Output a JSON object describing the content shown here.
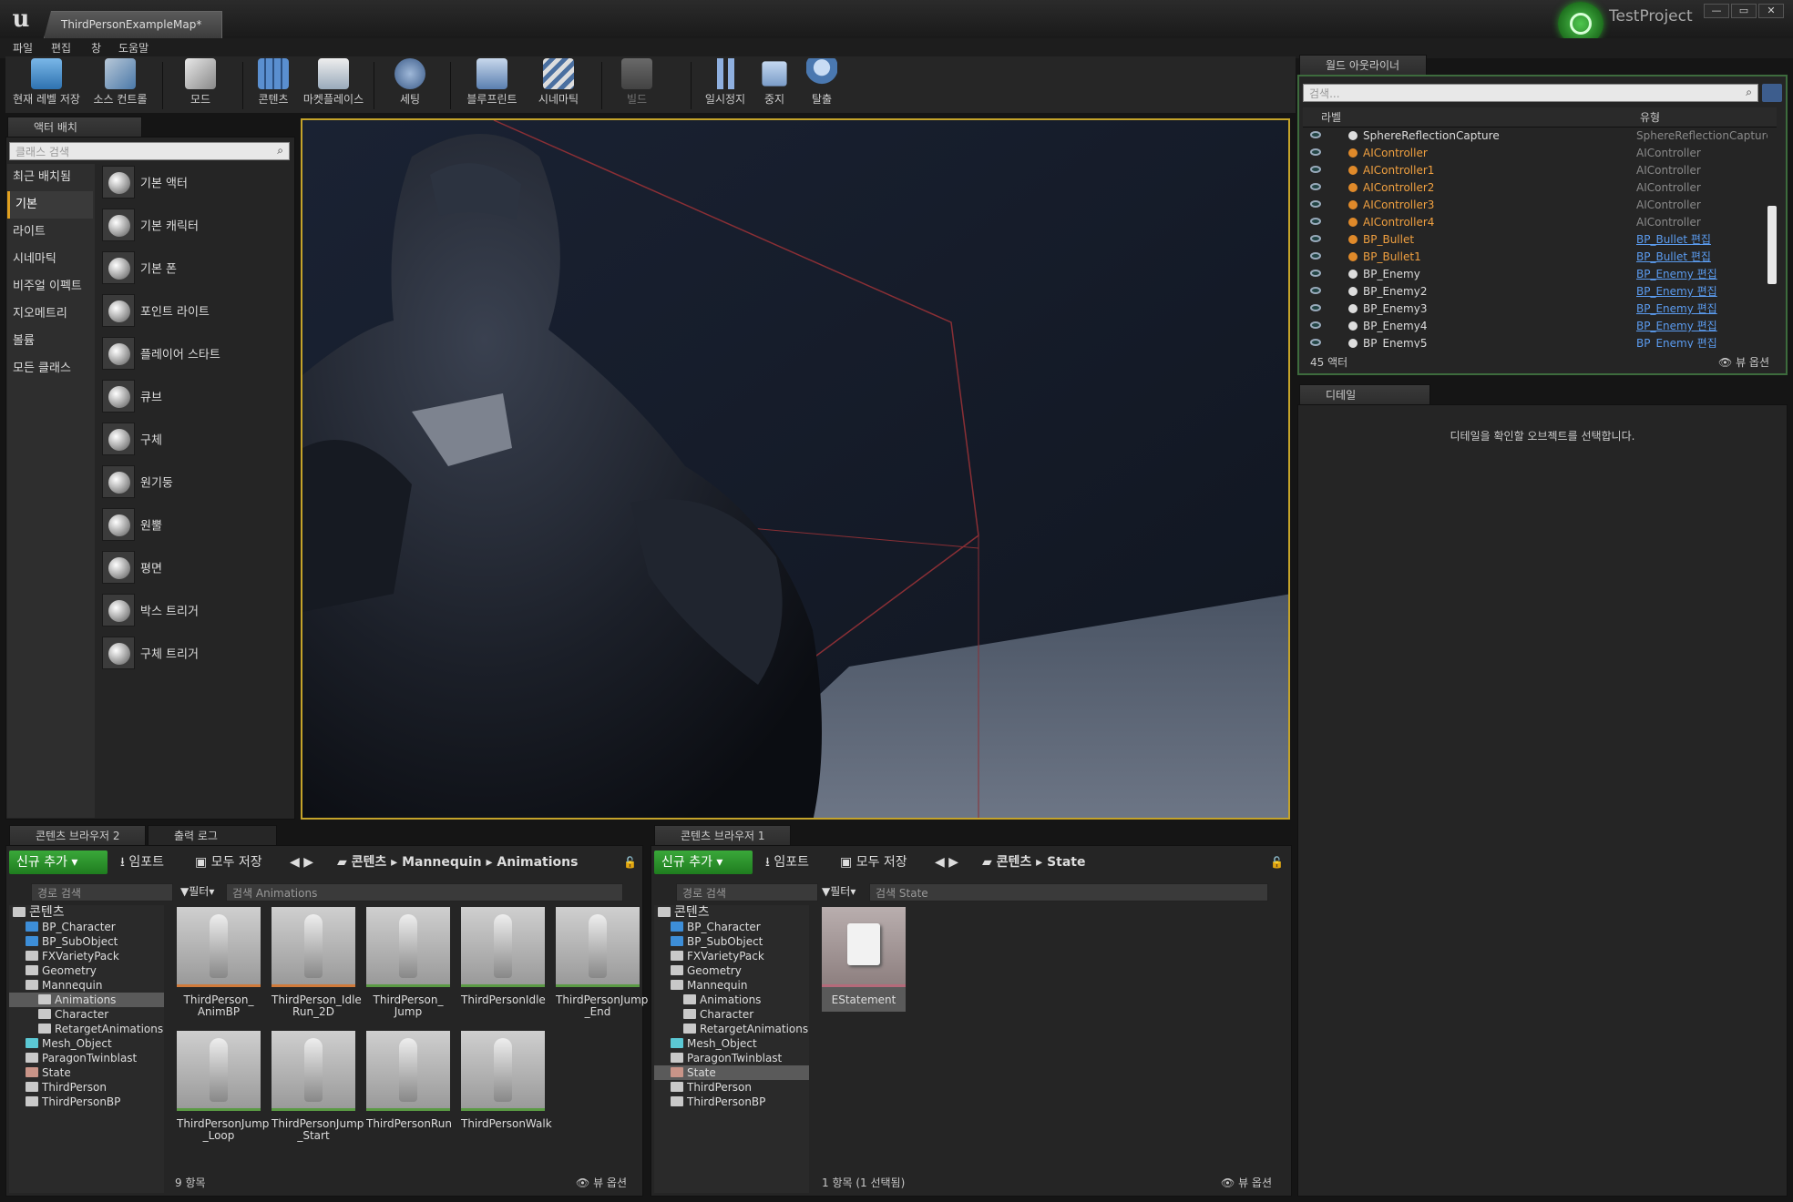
{
  "app": {
    "tab_title": "ThirdPersonExampleMap*",
    "project_name": "TestProject",
    "window_buttons": [
      "—",
      "▭",
      "✕"
    ]
  },
  "menu": [
    "파일",
    "편집",
    "창",
    "도움말"
  ],
  "toolbar": {
    "items": [
      {
        "label": "현재 레벨 저장",
        "icon": "save-icon"
      },
      {
        "label": "소스 컨트롤",
        "icon": "source-control-icon"
      },
      {
        "label": "모드",
        "icon": "modes-icon"
      },
      {
        "label": "콘텐츠",
        "icon": "content-icon"
      },
      {
        "label": "마켓플레이스",
        "icon": "marketplace-icon"
      },
      {
        "label": "세팅",
        "icon": "settings-icon"
      },
      {
        "label": "블루프린트",
        "icon": "blueprint-icon"
      },
      {
        "label": "시네마틱",
        "icon": "cinematics-icon"
      },
      {
        "label": "빌드",
        "icon": "build-icon"
      },
      {
        "label": "일시정지",
        "icon": "pause-icon"
      },
      {
        "label": "중지",
        "icon": "stop-icon"
      },
      {
        "label": "탈출",
        "icon": "eject-icon"
      }
    ]
  },
  "place_actors": {
    "tab_title": "액터 배치",
    "search_placeholder": "클래스 검색",
    "categories": [
      "최근 배치됨",
      "기본",
      "라이트",
      "시네마틱",
      "비주얼 이펙트",
      "지오메트리",
      "볼륨",
      "모든 클래스"
    ],
    "selected_category": "기본",
    "items": [
      "기본 액터",
      "기본 캐릭터",
      "기본 폰",
      "포인트 라이트",
      "플레이어 스타트",
      "큐브",
      "구체",
      "원기둥",
      "원뿔",
      "평면",
      "박스 트리거",
      "구체 트리거"
    ]
  },
  "world_outliner": {
    "tab_title": "월드 아웃라이너",
    "search_placeholder": "검색...",
    "col_label": "라벨",
    "col_type": "유형",
    "rows": [
      {
        "name": "SphereReflectionCapture",
        "type": "SphereReflectionCapture",
        "orange": false,
        "link": false
      },
      {
        "name": "AIController",
        "type": "AIController",
        "orange": true,
        "link": false
      },
      {
        "name": "AIController1",
        "type": "AIController",
        "orange": true,
        "link": false
      },
      {
        "name": "AIController2",
        "type": "AIController",
        "orange": true,
        "link": false
      },
      {
        "name": "AIController3",
        "type": "AIController",
        "orange": true,
        "link": false
      },
      {
        "name": "AIController4",
        "type": "AIController",
        "orange": true,
        "link": false
      },
      {
        "name": "BP_Bullet",
        "type": "BP_Bullet 편집",
        "orange": true,
        "link": true
      },
      {
        "name": "BP_Bullet1",
        "type": "BP_Bullet 편집",
        "orange": true,
        "link": true
      },
      {
        "name": "BP_Enemy",
        "type": "BP_Enemy 편집",
        "orange": false,
        "link": true
      },
      {
        "name": "BP_Enemy2",
        "type": "BP_Enemy 편집",
        "orange": false,
        "link": true
      },
      {
        "name": "BP_Enemy3",
        "type": "BP_Enemy 편집",
        "orange": false,
        "link": true
      },
      {
        "name": "BP_Enemy4",
        "type": "BP_Enemy 편집",
        "orange": false,
        "link": true
      },
      {
        "name": "BP_Enemy5",
        "type": "BP_Enemy 편집",
        "orange": false,
        "link": true
      }
    ],
    "actor_count": "45 액터",
    "view_options": "뷰 옵션"
  },
  "details": {
    "tab_title": "디테일",
    "empty_message": "디테일을 확인할 오브젝트를 선택합니다."
  },
  "content_browser_2": {
    "tab_title": "콘텐츠 브라우저 2",
    "output_tab": "출력 로그",
    "add_new": "신규 추가",
    "import": "임포트",
    "save_all": "모두 저장",
    "path": [
      "콘텐츠",
      "Mannequin",
      "Animations"
    ],
    "path_search": "경로 검색",
    "filter": "필터",
    "search_placeholder": "검색 Animations",
    "tree": [
      {
        "label": "콘텐츠",
        "depth": 0,
        "color": "grey",
        "selected": false
      },
      {
        "label": "BP_Character",
        "depth": 1,
        "color": "blue",
        "selected": false
      },
      {
        "label": "BP_SubObject",
        "depth": 1,
        "color": "blue",
        "selected": false
      },
      {
        "label": "FXVarietyPack",
        "depth": 1,
        "color": "grey",
        "selected": false
      },
      {
        "label": "Geometry",
        "depth": 1,
        "color": "grey",
        "selected": false
      },
      {
        "label": "Mannequin",
        "depth": 1,
        "color": "grey",
        "selected": false
      },
      {
        "label": "Animations",
        "depth": 2,
        "color": "grey",
        "selected": true
      },
      {
        "label": "Character",
        "depth": 2,
        "color": "grey",
        "selected": false
      },
      {
        "label": "RetargetAnimations",
        "depth": 2,
        "color": "grey",
        "selected": false
      },
      {
        "label": "Mesh_Object",
        "depth": 1,
        "color": "cyan",
        "selected": false
      },
      {
        "label": "ParagonTwinblast",
        "depth": 1,
        "color": "grey",
        "selected": false
      },
      {
        "label": "State",
        "depth": 1,
        "color": "pink",
        "selected": false
      },
      {
        "label": "ThirdPerson",
        "depth": 1,
        "color": "grey",
        "selected": false
      },
      {
        "label": "ThirdPersonBP",
        "depth": 1,
        "color": "grey",
        "selected": false
      }
    ],
    "assets": [
      {
        "label": "ThirdPerson_\nAnimBP",
        "kind": "anim"
      },
      {
        "label": "ThirdPerson_Idle\nRun_2D",
        "kind": "anim"
      },
      {
        "label": "ThirdPerson_\nJump",
        "kind": "seq"
      },
      {
        "label": "ThirdPersonIdle",
        "kind": "seq"
      },
      {
        "label": "ThirdPersonJump\n_End",
        "kind": "seq"
      },
      {
        "label": "ThirdPersonJump\n_Loop",
        "kind": "seq"
      },
      {
        "label": "ThirdPersonJump\n_Start",
        "kind": "seq"
      },
      {
        "label": "ThirdPersonRun",
        "kind": "seq"
      },
      {
        "label": "ThirdPersonWalk",
        "kind": "seq"
      }
    ],
    "count": "9 항목",
    "view_options": "뷰 옵션"
  },
  "content_browser_1": {
    "tab_title": "콘텐츠 브라우저 1",
    "add_new": "신규 추가",
    "import": "임포트",
    "save_all": "모두 저장",
    "path": [
      "콘텐츠",
      "State"
    ],
    "path_search": "경로 검색",
    "filter": "필터",
    "search_placeholder": "검색 State",
    "tree": [
      {
        "label": "콘텐츠",
        "depth": 0,
        "color": "grey",
        "selected": false
      },
      {
        "label": "BP_Character",
        "depth": 1,
        "color": "blue",
        "selected": false
      },
      {
        "label": "BP_SubObject",
        "depth": 1,
        "color": "blue",
        "selected": false
      },
      {
        "label": "FXVarietyPack",
        "depth": 1,
        "color": "grey",
        "selected": false
      },
      {
        "label": "Geometry",
        "depth": 1,
        "color": "grey",
        "selected": false
      },
      {
        "label": "Mannequin",
        "depth": 1,
        "color": "grey",
        "selected": false
      },
      {
        "label": "Animations",
        "depth": 2,
        "color": "grey",
        "selected": false
      },
      {
        "label": "Character",
        "depth": 2,
        "color": "grey",
        "selected": false
      },
      {
        "label": "RetargetAnimations",
        "depth": 2,
        "color": "grey",
        "selected": false
      },
      {
        "label": "Mesh_Object",
        "depth": 1,
        "color": "cyan",
        "selected": false
      },
      {
        "label": "ParagonTwinblast",
        "depth": 1,
        "color": "grey",
        "selected": false
      },
      {
        "label": "State",
        "depth": 1,
        "color": "pink",
        "selected": true
      },
      {
        "label": "ThirdPerson",
        "depth": 1,
        "color": "grey",
        "selected": false
      },
      {
        "label": "ThirdPersonBP",
        "depth": 1,
        "color": "grey",
        "selected": false
      }
    ],
    "assets": [
      {
        "label": "EStatement",
        "kind": "enum"
      }
    ],
    "count": "1 항목 (1 선택됨)",
    "view_options": "뷰 옵션"
  },
  "colors": {
    "accent_green": "#2f9a2f",
    "viewport_border": "#c4a32a",
    "link_blue": "#5b9cf0",
    "orange_icon": "#e08a2a"
  }
}
